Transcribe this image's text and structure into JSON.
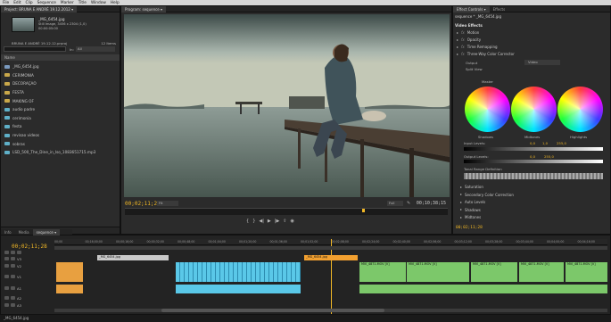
{
  "menu": [
    "File",
    "Edit",
    "Clip",
    "Sequence",
    "Marker",
    "Title",
    "Window",
    "Help"
  ],
  "project": {
    "tab": "Project: BRUNA E ANDRÉ 19.12.2012 ▾",
    "clip_name": "_MG_6454.jpg",
    "clip_info1": "Still Image, 3456 x 2304 (1,0)",
    "clip_info2": "00:00:05:00",
    "project_file": "BRUNA E ANDRÉ 19.12.12.prproj",
    "items_count": "12 Items",
    "search_placeholder": "",
    "in_label": "In:",
    "in_value": "All",
    "col_name": "Name",
    "items": [
      "_MG_6454.jpg",
      "CERIMONIA",
      "DECORAÇAO",
      "FESTA",
      "MAKING OF",
      "audio padre",
      "cerimonia",
      "festa",
      "revisao videos",
      "sobras",
      "LSD_500_The_Dine_in_lso_1083651715.mp3"
    ]
  },
  "monitor": {
    "tab": "Program: sequence ▾",
    "timecode": "00;02;11;28",
    "fit": "Fit",
    "full": "Full",
    "duration": "00;10;38;15"
  },
  "effect_controls": {
    "tabs": [
      "Effect Controls ▾",
      "Effects"
    ],
    "header": "sequence * _MG_6454.jpg",
    "title": "Video Effects",
    "rows": [
      "Motion",
      "Opacity",
      "Time Remapping",
      "Three-Way Color Corrector"
    ],
    "output_label": "Output",
    "output_value": "Video",
    "split_view": "Split View",
    "master": "Master",
    "wheels": [
      "Shadows",
      "Midtones",
      "Highlights"
    ],
    "input_levels": "Input Levels:",
    "input_vals": [
      "0,0",
      "1,0",
      "255,0"
    ],
    "output_levels": "Output Levels:",
    "output_vals": [
      "0,0",
      "255,0"
    ],
    "tonal": "Tonal Range Definition",
    "sub_rows": [
      "Saturation",
      "Secondary Color Correction",
      "Auto Levels",
      "Shadows",
      "Midtones"
    ],
    "timecode": "00;02;11;28"
  },
  "bottom_tabs": [
    "Info",
    "Media",
    "sequence ▾"
  ],
  "timeline": {
    "timecode": "00;02;11;28",
    "ticks": [
      "00;00",
      "00;16;00;00",
      "00;00;16;00",
      "00;00;32;00",
      "00;00;48;00",
      "00;01;04;00",
      "00;01;20;00",
      "00;01;36;00",
      "00;01;52;00",
      "00;02;08;00",
      "00;02;24;00",
      "00;02;40;00",
      "00;02;56;00",
      "00;03;12;00",
      "00;03;28;00",
      "00;03;44;00",
      "00;04;00;00",
      "00;04;16;00"
    ],
    "tracks": [
      "V3",
      "V2",
      "V1",
      "A1",
      "A2",
      "A3"
    ],
    "clips_top": [
      "_MG_6454.jpg",
      "_MG_6454.jpg"
    ],
    "clips_green": [
      "MVI_4871.MOV [V]",
      "MVI_4871.MOV [V]",
      "MVI_4871.MOV [V]",
      "MVI_4871.MOV [V]",
      "MVI_4871.MOV [V]"
    ]
  },
  "status_bar": "_MG_6454.jpg"
}
